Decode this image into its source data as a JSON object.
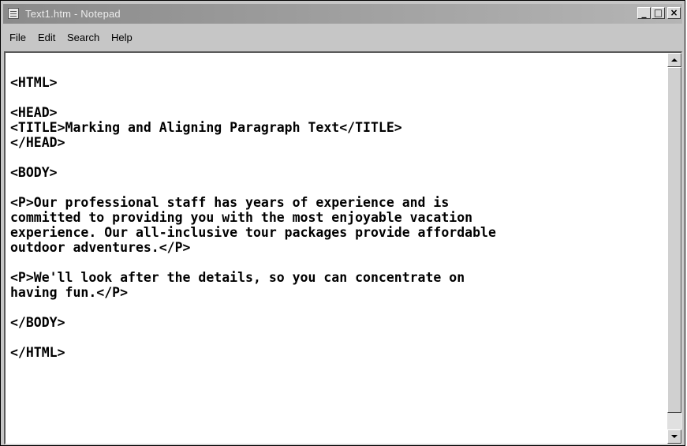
{
  "window": {
    "title": "Text1.htm - Notepad",
    "icon": "notepad-icon",
    "controls": [
      "minimize-icon",
      "maximize-icon",
      "close-icon"
    ]
  },
  "menu": {
    "file": "File",
    "edit": "Edit",
    "search": "Search",
    "help": "Help"
  },
  "editor": {
    "lines": [
      "<HTML>",
      "",
      "<HEAD>",
      "<TITLE>Marking and Aligning Paragraph Text</TITLE>",
      "</HEAD>",
      "",
      "<BODY>",
      "",
      "<P>Our professional staff has years of experience and is",
      "committed to providing you with the most enjoyable vacation",
      "experience. Our all-inclusive tour packages provide affordable",
      "outdoor adventures.</P>",
      "",
      "<P>We'll look after the details, so you can concentrate on",
      "having fun.</P>",
      "",
      "</BODY>",
      "",
      "</HTML>"
    ]
  }
}
